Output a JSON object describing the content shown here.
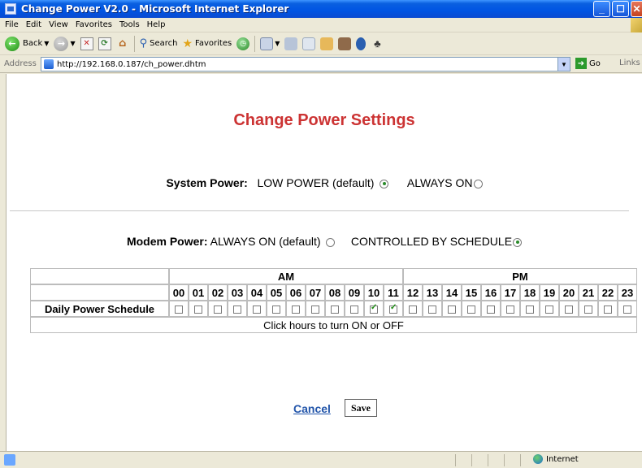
{
  "window": {
    "title": "Change Power V2.0 - Microsoft Internet Explorer"
  },
  "menu": [
    "File",
    "Edit",
    "View",
    "Favorites",
    "Tools",
    "Help"
  ],
  "toolbar": {
    "back_label": "Back",
    "search_label": "Search",
    "favorites_label": "Favorites"
  },
  "address": {
    "label": "Address",
    "url": "http://192.168.0.187/ch_power.dhtm",
    "go_label": "Go",
    "links_label": "Links"
  },
  "page": {
    "title": "Change Power Settings",
    "system_power": {
      "label": "System Power:",
      "option1": "LOW POWER (default)",
      "option2": "ALWAYS ON",
      "selected": "option1"
    },
    "modem_power": {
      "label": "Modem Power:",
      "option1": "ALWAYS ON (default)",
      "option2": "CONTROLLED BY SCHEDULE",
      "selected": "option2"
    },
    "schedule": {
      "am_label": "AM",
      "pm_label": "PM",
      "hours": [
        "00",
        "01",
        "02",
        "03",
        "04",
        "05",
        "06",
        "07",
        "08",
        "09",
        "10",
        "11",
        "12",
        "13",
        "14",
        "15",
        "16",
        "17",
        "18",
        "19",
        "20",
        "21",
        "22",
        "23"
      ],
      "row_label": "Daily Power Schedule",
      "on_hours": [
        "10",
        "11"
      ],
      "hint": "Click hours to turn ON or OFF"
    },
    "cancel_label": "Cancel",
    "save_label": "Save"
  },
  "status": {
    "zone": "Internet"
  }
}
